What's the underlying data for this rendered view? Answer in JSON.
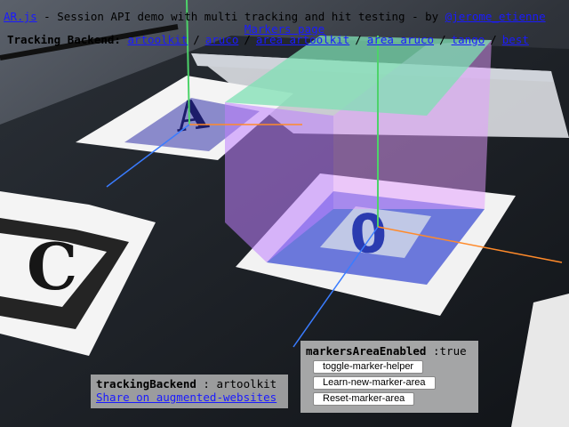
{
  "header": {
    "app_link": "AR.js",
    "title_text": " - Session API demo with multi tracking and hit testing - by ",
    "author_link": "@jerome_etienne",
    "markers_page_link": "Markers page",
    "backend_label": "Tracking Backend:",
    "separator": "/",
    "backends": [
      "artoolkit",
      "aruco",
      "area artoolkit",
      "area aruco",
      "tango",
      "best"
    ]
  },
  "status_panel": {
    "tracking_key": "trackingBackend",
    "tracking_value": " : artoolkit",
    "share_link": "Share on augmented-websites"
  },
  "area_panel": {
    "key": "markersAreaEnabled",
    "value": " :true",
    "buttons": [
      "toggle-marker-helper",
      "Learn-new-marker-area",
      "Reset-marker-area"
    ]
  },
  "scene": {
    "marker_a_letter": "A",
    "marker_c_letter": "C",
    "marker_zero_glyph": "0",
    "colors": {
      "cube_top": "#7fe0b4",
      "cube_side": "#c080ff",
      "cube_back": "#e49cff",
      "axis_x": "#ff8a2a",
      "axis_y": "#4dd36a",
      "axis_z": "#3a7cff"
    }
  }
}
